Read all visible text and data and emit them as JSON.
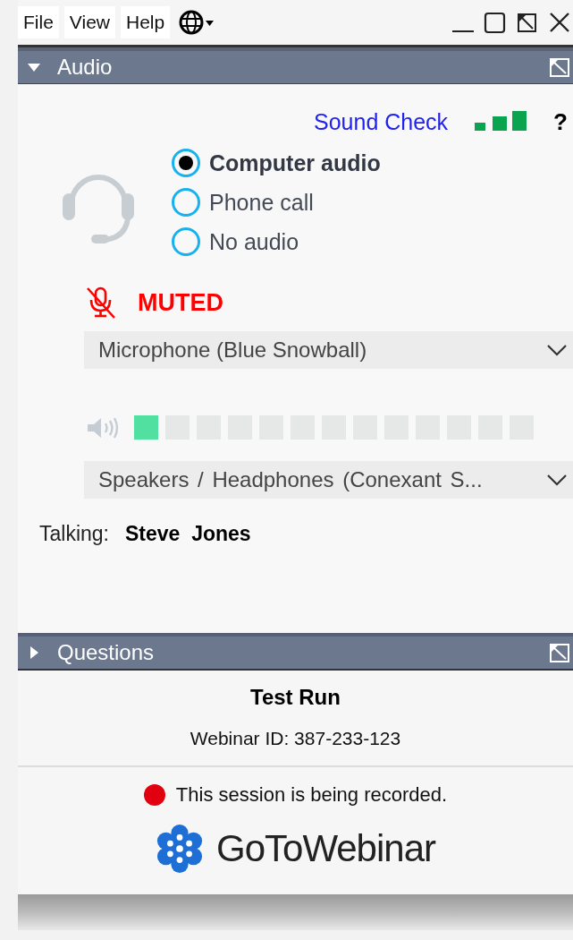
{
  "menu": [
    "File",
    "View",
    "Help"
  ],
  "sections": [
    {
      "title": "Audio",
      "expanded": true
    },
    {
      "title": "Questions",
      "expanded": false
    }
  ],
  "audio": {
    "sound_check": "Sound Check",
    "help": "?",
    "modes": [
      {
        "label": "Computer audio",
        "selected": true
      },
      {
        "label": "Phone call",
        "selected": false
      },
      {
        "label": "No audio",
        "selected": false
      }
    ],
    "muted": true,
    "muted_label": "MUTED",
    "microphone": "Microphone (Blue Snowball)",
    "speaker_meter": {
      "level": 0.06
    },
    "speakers": "Speakers / Headphones (Conexant S...",
    "talking_label": "Talking:",
    "talking_name": "Steve  Jones"
  },
  "session": {
    "title": "Test Run",
    "webinar_id": "Webinar ID: 387-233-123",
    "recording": "This session is being recorded.",
    "logo": "**GoTo**Webinar"
  }
}
